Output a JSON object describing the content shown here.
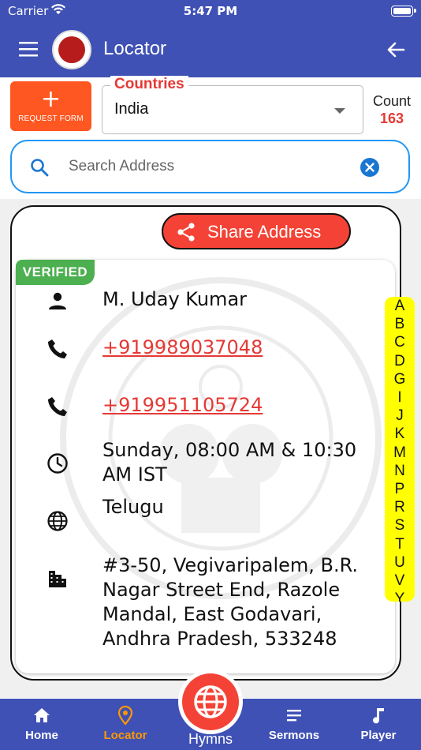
{
  "status": {
    "carrier": "Carrier",
    "time": "5:47 PM"
  },
  "appbar": {
    "title": "Locator",
    "menu_icon": "menu-icon",
    "back_icon": "arrow-left-icon"
  },
  "request_form": {
    "label": "REQUEST FORM"
  },
  "countries": {
    "legend": "Countries",
    "value": "India"
  },
  "count": {
    "label": "Count",
    "value": "163"
  },
  "search": {
    "placeholder": "Search Address"
  },
  "share": {
    "label": "Share Address"
  },
  "card": {
    "badge": "VERIFIED",
    "name": "M. Uday Kumar",
    "phone1": "+919989037048",
    "phone2": "+919951105724",
    "timing": "Sunday, 08:00 AM & 10:30 AM IST",
    "language": "Telugu",
    "address": "#3-50, Vegivaripalem, B.R. Nagar Street End, Razole Mandal, East Godavari, Andhra Pradesh, 533248"
  },
  "alphabet": [
    "A",
    "B",
    "C",
    "D",
    "G",
    "I",
    "J",
    "K",
    "M",
    "N",
    "P",
    "R",
    "S",
    "T",
    "U",
    "V",
    "Y"
  ],
  "nav": {
    "items": [
      {
        "label": "Home",
        "icon": "home-icon"
      },
      {
        "label": "Locator",
        "icon": "location-pin-icon"
      },
      {
        "label": "Sermons",
        "icon": "list-icon"
      },
      {
        "label": "Player",
        "icon": "music-note-icon"
      }
    ],
    "fab_label": "Hymns"
  },
  "colors": {
    "primary": "#3f51b5",
    "accent": "#f44336",
    "orange": "#ff5722",
    "verified": "#4caf50",
    "active_nav": "#ff9800",
    "alpha_bar": "#ffff00"
  }
}
